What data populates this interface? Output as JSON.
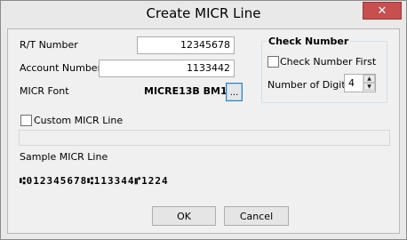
{
  "window": {
    "title": "Create MICR Line",
    "close_glyph": "✕"
  },
  "fields": {
    "rt_label": "R/T Number",
    "rt_value": "12345678",
    "account_label": "Account Number",
    "account_value": "1133442",
    "font_label": "MICR Font",
    "font_value": "MICRE13B BM1",
    "font_button": "..."
  },
  "check_group": {
    "title": "Check Number",
    "first_label": "Check Number First",
    "first_checked": false,
    "digits_label": "Number of Digits",
    "digits_value": "4"
  },
  "custom": {
    "label": "Custom MICR Line",
    "checked": false
  },
  "sample": {
    "label": "Sample MICR Line",
    "text": "⑆012345678⑆113344⑈1224"
  },
  "buttons": {
    "ok": "OK",
    "cancel": "Cancel"
  },
  "icons": {
    "close": "close-icon",
    "spin_up": "up-arrow-icon",
    "spin_down": "down-arrow-icon"
  }
}
